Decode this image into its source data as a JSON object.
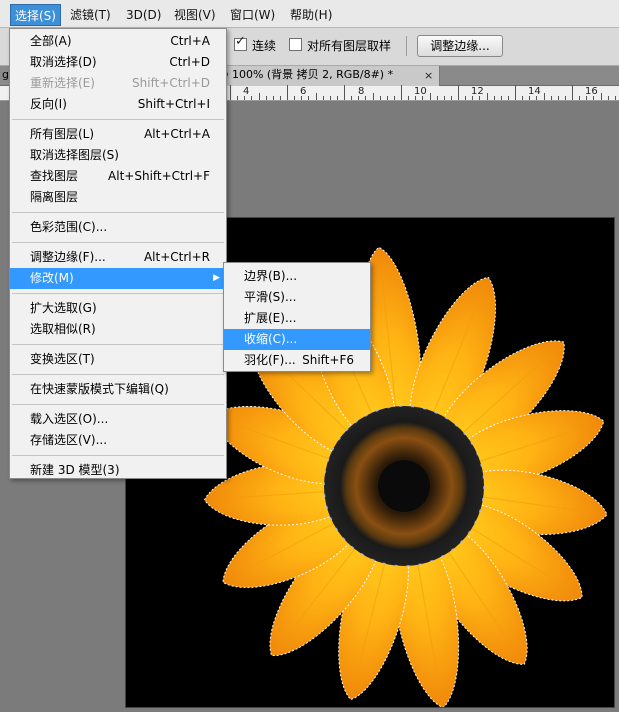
{
  "menubar": {
    "items": [
      {
        "label": "选择(S)",
        "active": true
      },
      {
        "label": "滤镜(T)"
      },
      {
        "label": "3D(D)"
      },
      {
        "label": "视图(V)"
      },
      {
        "label": "窗口(W)"
      },
      {
        "label": "帮助(H)"
      }
    ]
  },
  "options": {
    "contiguous_label": "连续",
    "contiguous_checked": true,
    "sample_all_label": "对所有图层取样",
    "sample_all_checked": false,
    "refine_edge_label": "调整边缘..."
  },
  "tabs": {
    "doc_left": "g",
    "document": "ng @ 100% (背景 拷贝 2, RGB/8#) *",
    "close": "×"
  },
  "ruler": {
    "labels": [
      "4",
      "6",
      "8",
      "10",
      "12",
      "14",
      "16"
    ]
  },
  "select_menu": {
    "items": [
      {
        "label": "全部(A)",
        "shortcut": "Ctrl+A"
      },
      {
        "label": "取消选择(D)",
        "shortcut": "Ctrl+D"
      },
      {
        "label": "重新选择(E)",
        "shortcut": "Shift+Ctrl+D",
        "disabled": true
      },
      {
        "label": "反向(I)",
        "shortcut": "Shift+Ctrl+I"
      },
      {
        "sep": true
      },
      {
        "label": "所有图层(L)",
        "shortcut": "Alt+Ctrl+A"
      },
      {
        "label": "取消选择图层(S)",
        "shortcut": ""
      },
      {
        "label": "查找图层",
        "shortcut": "Alt+Shift+Ctrl+F"
      },
      {
        "label": "隔离图层",
        "shortcut": ""
      },
      {
        "sep": true
      },
      {
        "label": "色彩范围(C)...",
        "shortcut": ""
      },
      {
        "sep": true
      },
      {
        "label": "调整边缘(F)...",
        "shortcut": "Alt+Ctrl+R"
      },
      {
        "label": "修改(M)",
        "shortcut": "",
        "highlighted": true,
        "submenu": true
      },
      {
        "sep": true
      },
      {
        "label": "扩大选取(G)",
        "shortcut": ""
      },
      {
        "label": "选取相似(R)",
        "shortcut": ""
      },
      {
        "sep": true
      },
      {
        "label": "变换选区(T)",
        "shortcut": ""
      },
      {
        "sep": true
      },
      {
        "label": "在快速蒙版模式下编辑(Q)",
        "shortcut": ""
      },
      {
        "sep": true
      },
      {
        "label": "载入选区(O)...",
        "shortcut": ""
      },
      {
        "label": "存储选区(V)...",
        "shortcut": ""
      },
      {
        "sep": true
      },
      {
        "label": "新建 3D 模型(3)",
        "shortcut": ""
      }
    ]
  },
  "modify_submenu": {
    "items": [
      {
        "label": "边界(B)...",
        "shortcut": ""
      },
      {
        "label": "平滑(S)...",
        "shortcut": ""
      },
      {
        "label": "扩展(E)...",
        "shortcut": ""
      },
      {
        "label": "收缩(C)...",
        "shortcut": "",
        "highlighted": true
      },
      {
        "label": "羽化(F)...",
        "shortcut": "Shift+F6"
      }
    ]
  },
  "colors": {
    "menu_highlight": "#3399ff",
    "menubar_active": "#3d8fd8",
    "petal_outer": "#f59a0c",
    "petal_inner": "#ffd21f",
    "flower_center": "#1d1d1d"
  }
}
